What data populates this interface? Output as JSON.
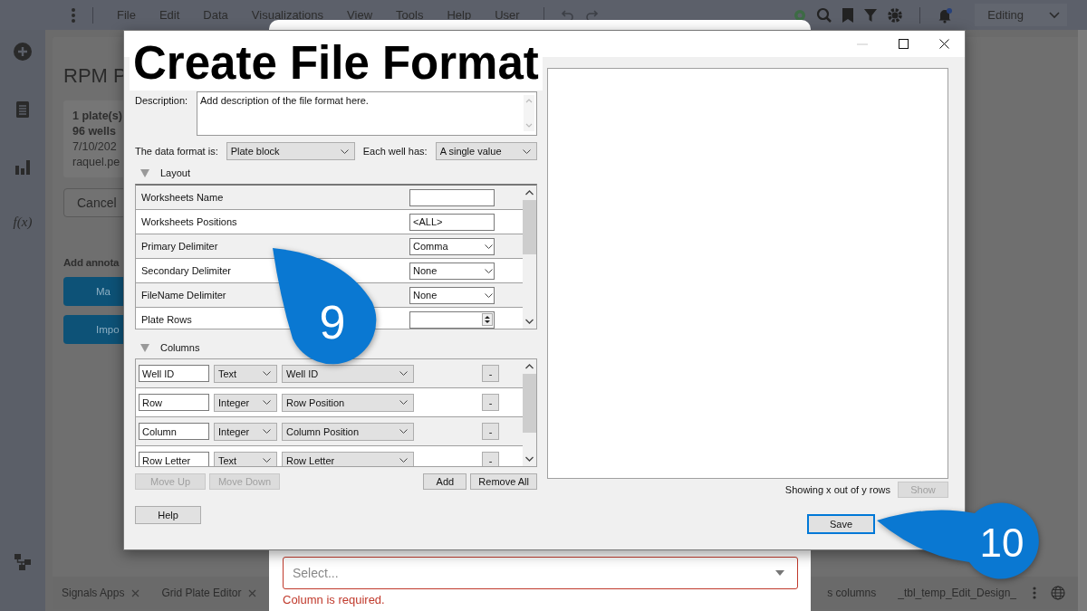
{
  "menu_bar": {
    "items": [
      "File",
      "Edit",
      "Data",
      "Visualizations",
      "View",
      "Tools",
      "Help",
      "User"
    ],
    "mode": "Editing"
  },
  "side_rail": {
    "formula_label": "f(x)"
  },
  "background_panel": {
    "title": "RPM P",
    "card_lines": [
      {
        "text": "1 plate(s)",
        "bold": true
      },
      {
        "text": "96 wells",
        "bold": true
      },
      {
        "text": "7/10/202",
        "bold": false
      },
      {
        "text": "raquel.pe",
        "bold": false
      }
    ],
    "cancel": "Cancel",
    "annotations_label": "Add annota",
    "buttons": [
      "Ma",
      "Impo"
    ]
  },
  "bottom_tabs": [
    {
      "label": "Signals Apps",
      "closable": true
    },
    {
      "label": "Grid Plate Editor",
      "closable": true
    },
    {
      "label": "s columns",
      "closable": false
    },
    {
      "label": "_tbl_temp_Edit_Design_",
      "closable": false
    }
  ],
  "back_modal": {
    "select_placeholder": "Select...",
    "error": "Column is required."
  },
  "dialog": {
    "title_overlay": "Create File Format",
    "description_label": "Description:",
    "description_value": "Add description of the file format here.",
    "data_format_label": "The data format is:",
    "data_format_value": "Plate block",
    "each_well_label": "Each well has:",
    "each_well_value": "A single value",
    "layout": {
      "title": "Layout",
      "expanded": true,
      "rows": [
        {
          "label": "Worksheets Name",
          "kind": "text"
        },
        {
          "label": "Worksheets Positions",
          "kind": "text",
          "value": "<ALL>"
        },
        {
          "label": "Primary Delimiter",
          "kind": "dropdown",
          "value": "Comma"
        },
        {
          "label": "Secondary Delimiter",
          "kind": "dropdown",
          "value": "None"
        },
        {
          "label": "FileName Delimiter",
          "kind": "dropdown",
          "value": "None"
        },
        {
          "label": "Plate Rows",
          "kind": "spinner"
        }
      ]
    },
    "columns": {
      "title": "Columns",
      "expanded": true,
      "rows": [
        {
          "name": "Well ID",
          "type": "Text",
          "mapping": "Well ID",
          "remove": "-"
        },
        {
          "name": "Row",
          "type": "Integer",
          "mapping": "Row Position",
          "remove": "-"
        },
        {
          "name": "Column",
          "type": "Integer",
          "mapping": "Column Position",
          "remove": "-"
        },
        {
          "name": "Row Letter",
          "type": "Text",
          "mapping": "Row Letter",
          "remove": "-"
        }
      ]
    },
    "column_buttons": [
      {
        "label": "Move Up",
        "disabled": true
      },
      {
        "label": "Move Down",
        "disabled": true
      },
      {
        "label": "Add",
        "disabled": false
      },
      {
        "label": "Remove All",
        "disabled": false
      }
    ],
    "help": "Help",
    "status": "Showing x out of y rows",
    "show_button": {
      "label": "Show",
      "disabled": true
    },
    "save": "Save"
  },
  "callouts": [
    "9",
    "10"
  ]
}
